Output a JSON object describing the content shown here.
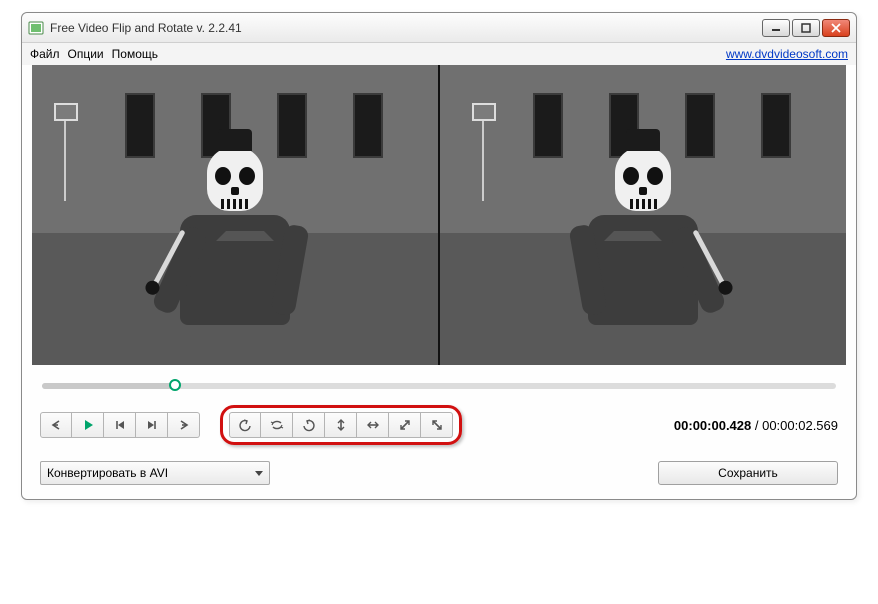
{
  "window": {
    "title": "Free Video Flip and Rotate v. 2.2.41"
  },
  "menu": {
    "file": "Файл",
    "options": "Опции",
    "help": "Помощь"
  },
  "link": {
    "url_text": "www.dvdvideosoft.com"
  },
  "time": {
    "current": "00:00:00.428",
    "sep": " / ",
    "total": "00:00:02.569"
  },
  "convert": {
    "selected": "Конвертировать в AVI"
  },
  "save": {
    "label": "Сохранить"
  },
  "colors": {
    "accent": "#00a46b",
    "highlight_border": "#d11010"
  }
}
